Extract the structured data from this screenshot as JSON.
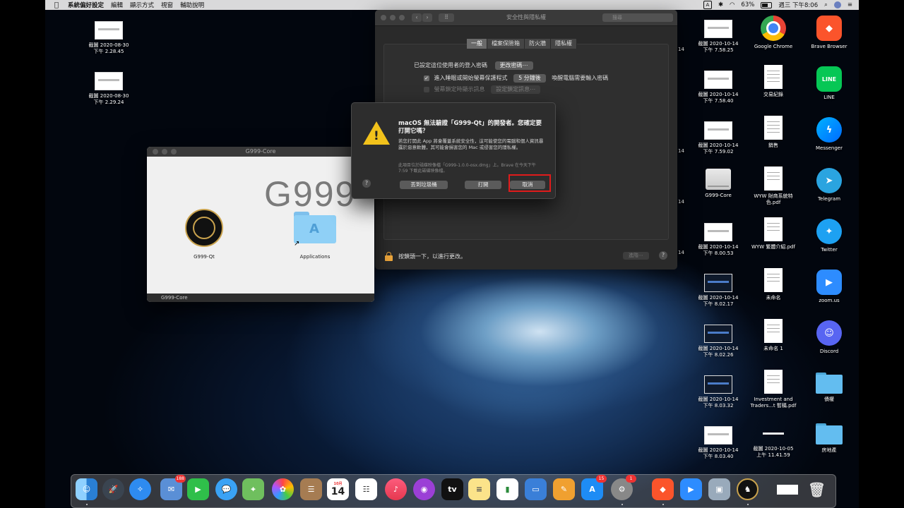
{
  "menubar": {
    "app_name": "系統偏好設定",
    "menus": [
      "編輯",
      "顯示方式",
      "視窗",
      "輔助說明"
    ],
    "input_label": "A",
    "battery": "63%",
    "clock": "週三 下午8:06"
  },
  "prefs": {
    "title": "安全性與隱私權",
    "search_placeholder": "搜尋",
    "tabs": [
      "一般",
      "檔案保險箱",
      "防火牆",
      "隱私權"
    ],
    "password_label": "已設定這位使用者的登入密碼",
    "change_password_button": "更改密碼⋯",
    "require_label": "進入睡眠或開始螢幕保護程式",
    "require_delay": "5 分鐘後",
    "require_suffix": "喚醒電腦需要輸入密碼",
    "lock_message_label": "螢幕鎖定時顯示訊息",
    "lock_message_button": "設定鎖定訊息⋯",
    "lock_text": "按鎖頭一下，以進行更改。",
    "advanced_button": "進階⋯",
    "help": "?"
  },
  "dmg": {
    "title": "G999-Core",
    "big_text": "G999",
    "app_label": "G999-Qt",
    "folder_label": "Applications",
    "status": "G999-Core"
  },
  "alert": {
    "title": "macOS 無法驗證「G999-Qt」的開發者。您確定要打開它嗎？",
    "body": "若您打開此 App 將會覆蓋系統安全性，這可能使您的電腦和個人資訊暴露於惡意軟體，其可能會損害您的 Mac 或侵害您的隱私權。",
    "note": "此項目位於磁碟映像檔「G999-1.0.0-osx.dmg」上。Brave 在今天下午 7:59 下載此磁碟映像檔。",
    "trash_button": "丟到垃圾桶",
    "open_button": "打開",
    "cancel_button": "取消",
    "help": "?"
  },
  "desktop": {
    "left_icons": [
      {
        "line1": "截圖 2020-08-30",
        "line2": "下午 2.28.45"
      },
      {
        "line1": "截圖 2020-08-30",
        "line2": "下午 2.29.24"
      }
    ],
    "col1": [
      {
        "line1": "截圖 2020-10-14",
        "line2": "下午 7.58.25"
      },
      {
        "line1": "截圖 2020-10-14",
        "line2": "下午 7.58.40"
      },
      {
        "line1": "截圖 2020-10-14",
        "line2": "下午 7.59.02"
      },
      {
        "line1": "G999-Core",
        "line2": ""
      },
      {
        "line1": "截圖 2020-10-14",
        "line2": "下午 8.00.53"
      },
      {
        "line1": "截圖 2020-10-14",
        "line2": "下午 8.02.17"
      },
      {
        "line1": "截圖 2020-10-14",
        "line2": "下午 8.02.26"
      },
      {
        "line1": "截圖 2020-10-14",
        "line2": "下午 8.03.32"
      },
      {
        "line1": "截圖 2020-10-14",
        "line2": "下午 8.03.40"
      }
    ],
    "col2": [
      {
        "line1": "Google Chrome",
        "line2": ""
      },
      {
        "line1": "交易紀錄",
        "line2": ""
      },
      {
        "line1": "銷售",
        "line2": ""
      },
      {
        "line1": "WYW 財商系統特",
        "line2": "色.pdf"
      },
      {
        "line1": "WYW 繁體介紹.pdf",
        "line2": ""
      },
      {
        "line1": "未命名",
        "line2": ""
      },
      {
        "line1": "未命名 1",
        "line2": ""
      },
      {
        "line1": "Investment and",
        "line2": "Traders...t 暫稱.pdf"
      },
      {
        "line1": "截圖 2020-10-05",
        "line2": "上午 11.41.59"
      }
    ],
    "col3": [
      {
        "line1": "Brave Browser",
        "line2": ""
      },
      {
        "line1": "LINE",
        "line2": ""
      },
      {
        "line1": "Messenger",
        "line2": ""
      },
      {
        "line1": "Telegram",
        "line2": ""
      },
      {
        "line1": "Twitter",
        "line2": ""
      },
      {
        "line1": "zoom.us",
        "line2": ""
      },
      {
        "line1": "Discord",
        "line2": ""
      },
      {
        "line1": "債權",
        "line2": ""
      },
      {
        "line1": "房地產",
        "line2": ""
      }
    ],
    "cut_label": "14"
  },
  "dock": {
    "mail_badge": "188",
    "appstore_badge": "15",
    "prefs_badge": "1",
    "calendar_month": "10月",
    "calendar_day": "14",
    "line_icon_text": "LINE"
  },
  "colors": {
    "accent": "#f2c21b",
    "highlight_box": "#e01b1b",
    "menubar": "#ebebeb"
  }
}
